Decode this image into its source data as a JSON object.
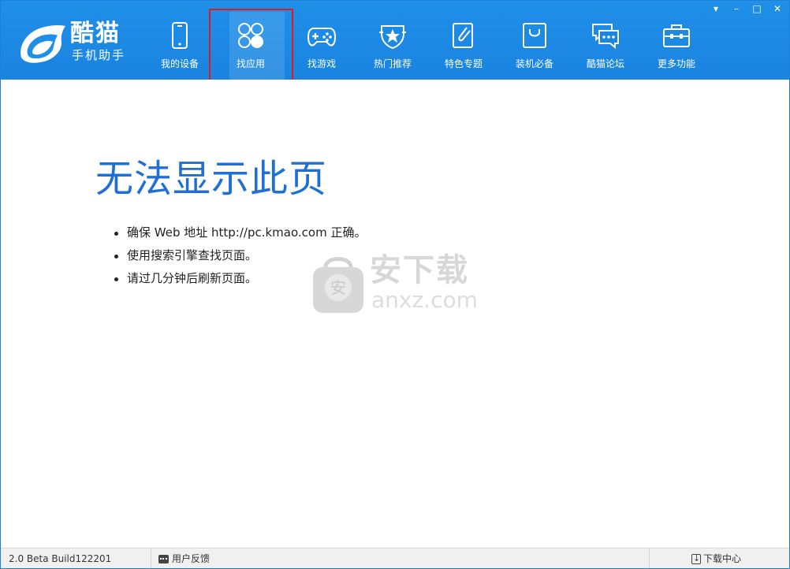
{
  "app": {
    "logo_title": "酷猫",
    "logo_subtitle": "手机助手"
  },
  "nav": [
    {
      "label": "我的设备",
      "icon": "phone-icon"
    },
    {
      "label": "找应用",
      "icon": "apps-icon",
      "active": true
    },
    {
      "label": "找游戏",
      "icon": "gamepad-icon"
    },
    {
      "label": "热门推荐",
      "icon": "star-badge-icon"
    },
    {
      "label": "特色专题",
      "icon": "paperclip-icon"
    },
    {
      "label": "装机必备",
      "icon": "bag-icon"
    },
    {
      "label": "酷猫论坛",
      "icon": "chat-bubbles-icon"
    },
    {
      "label": "更多功能",
      "icon": "toolbox-icon"
    }
  ],
  "window_controls": {
    "menu": "▾",
    "minimize": "–",
    "maximize": "□",
    "close": "✕"
  },
  "error_page": {
    "title": "无法显示此页",
    "items": [
      "确保 Web 地址 http://pc.kmao.com 正确。",
      "使用搜索引擎查找页面。",
      "请过几分钟后刷新页面。"
    ]
  },
  "watermark": {
    "text_cn": "安下载",
    "text_en": "anxz.com",
    "badge": "安"
  },
  "status": {
    "version": "2.0 Beta Build122201",
    "feedback": "用户反馈",
    "download": "下载中心"
  },
  "colors": {
    "header": "#1a84e0",
    "title": "#1f6fd6",
    "highlight": "#e01a1a"
  }
}
